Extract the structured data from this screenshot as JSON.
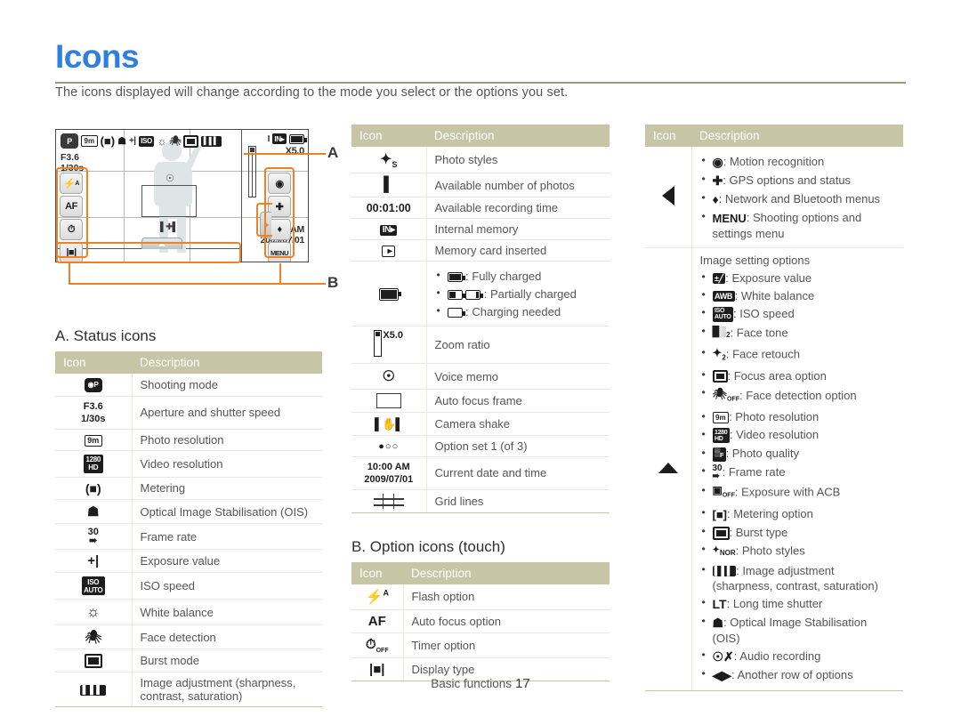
{
  "page": {
    "title": "Icons",
    "subtitle": "The icons displayed will change according to the mode you select or the options you set.",
    "footer_text": "Basic functions",
    "footer_page": "17",
    "accent_color": "#2e7fe0",
    "header_color": "#c6c5a6",
    "callout_color": "#f08020"
  },
  "diagram": {
    "label_a": "A",
    "label_b": "B",
    "aperture": "F3.6",
    "shutter": "1/30s",
    "zoom_ratio": "X5.0",
    "time": "10:00AM",
    "date": "2009/07/01",
    "mode_badge": "P",
    "left_buttons": [
      "flash-auto-icon",
      "af-icon",
      "timer-off-icon",
      "display-type-icon"
    ],
    "right_buttons": [
      "motion-recognition-icon",
      "gps-icon",
      "network-bluetooth-icon",
      "MENU"
    ],
    "menu_label": "MENU",
    "af_label": "AF"
  },
  "section_a": {
    "heading": "A. Status icons",
    "columns": [
      "Icon",
      "Description"
    ],
    "rows": [
      {
        "icon": "shooting-mode-icon",
        "desc": "Shooting mode"
      },
      {
        "icon": "aperture-shutter-icon",
        "desc": "Aperture and shutter speed",
        "icon_text_1": "F3.6",
        "icon_text_2": "1/30s"
      },
      {
        "icon": "photo-resolution-icon",
        "desc": "Photo resolution"
      },
      {
        "icon": "video-resolution-icon",
        "desc": "Video resolution"
      },
      {
        "icon": "metering-icon",
        "desc": "Metering"
      },
      {
        "icon": "ois-icon",
        "desc": "Optical Image Stabilisation (OIS)"
      },
      {
        "icon": "frame-rate-icon",
        "desc": "Frame rate"
      },
      {
        "icon": "exposure-value-icon",
        "desc": "Exposure value"
      },
      {
        "icon": "iso-speed-icon",
        "desc": "ISO speed"
      },
      {
        "icon": "white-balance-icon",
        "desc": "White balance"
      },
      {
        "icon": "face-detection-icon",
        "desc": "Face detection"
      },
      {
        "icon": "burst-mode-icon",
        "desc": "Burst mode"
      },
      {
        "icon": "image-adjustment-icon",
        "desc": "Image adjustment (sharpness, contrast, saturation)"
      }
    ]
  },
  "middle_table": {
    "columns": [
      "Icon",
      "Description"
    ],
    "rows": [
      {
        "icon": "photo-styles-icon",
        "desc": "Photo styles"
      },
      {
        "icon": "available-photos-icon",
        "desc": "Available number of photos"
      },
      {
        "icon": "recording-time-icon",
        "icon_text": "00:01:00",
        "desc": "Available recording time"
      },
      {
        "icon": "internal-memory-icon",
        "desc": "Internal memory"
      },
      {
        "icon": "memory-card-icon",
        "desc": "Memory card inserted"
      },
      {
        "icon": "battery-icon",
        "desc": "",
        "bullets": [
          "Fully charged",
          "Partially charged",
          "Charging needed"
        ]
      },
      {
        "icon": "zoom-ratio-icon",
        "icon_text": "X5.0",
        "desc": "Zoom ratio"
      },
      {
        "icon": "voice-memo-icon",
        "desc": "Voice memo"
      },
      {
        "icon": "auto-focus-frame-icon",
        "desc": "Auto focus frame"
      },
      {
        "icon": "camera-shake-icon",
        "desc": "Camera shake"
      },
      {
        "icon": "option-set-icon",
        "desc": "Option set 1 (of 3)"
      },
      {
        "icon": "date-time-icon",
        "icon_text_1": "10:00 AM",
        "icon_text_2": "2009/07/01",
        "desc": "Current date and time"
      },
      {
        "icon": "grid-lines-icon",
        "desc": "Grid lines"
      }
    ]
  },
  "section_b": {
    "heading": "B. Option icons (touch)",
    "columns": [
      "Icon",
      "Description"
    ],
    "rows": [
      {
        "icon": "flash-option-icon",
        "desc": "Flash option"
      },
      {
        "icon": "auto-focus-option-icon",
        "icon_text": "AF",
        "desc": "Auto focus option"
      },
      {
        "icon": "timer-option-icon",
        "desc": "Timer option"
      },
      {
        "icon": "display-type-icon",
        "desc": "Display type"
      }
    ]
  },
  "right_table": {
    "columns": [
      "Icon",
      "Description"
    ],
    "row1": {
      "icon": "left-triangle-icon",
      "bullets": [
        {
          "icon": "motion-recognition-icon",
          "text": "Motion recognition"
        },
        {
          "icon": "gps-icon",
          "text": "GPS options and status"
        },
        {
          "icon": "network-bluetooth-icon",
          "text": "Network and Bluetooth menus"
        },
        {
          "icon": "menu-icon",
          "label": "MENU",
          "text": "Shooting options and settings menu"
        }
      ]
    },
    "row2": {
      "icon": "up-triangle-icon",
      "note": "Image setting options",
      "bullets": [
        {
          "icon": "exposure-value-icon",
          "text": "Exposure value"
        },
        {
          "icon": "white-balance-icon",
          "text": "White balance"
        },
        {
          "icon": "iso-speed-icon",
          "text": "ISO speed"
        },
        {
          "icon": "face-tone-icon",
          "text": "Face tone"
        },
        {
          "icon": "face-retouch-icon",
          "text": "Face retouch"
        },
        {
          "icon": "focus-area-icon",
          "text": "Focus area option"
        },
        {
          "icon": "face-detection-option-icon",
          "text": "Face detection option"
        },
        {
          "icon": "photo-resolution-icon",
          "text": "Photo resolution"
        },
        {
          "icon": "video-resolution-icon",
          "text": "Video resolution"
        },
        {
          "icon": "photo-quality-icon",
          "text": "Photo quality"
        },
        {
          "icon": "frame-rate-icon",
          "text": "Frame rate"
        },
        {
          "icon": "acb-icon",
          "text": "Exposure with ACB"
        },
        {
          "icon": "metering-option-icon",
          "text": "Metering option"
        },
        {
          "icon": "burst-type-icon",
          "text": "Burst type"
        },
        {
          "icon": "photo-styles-icon",
          "text": "Photo styles"
        },
        {
          "icon": "image-adjustment-icon",
          "text": "Image adjustment (sharpness, contrast, saturation)"
        },
        {
          "icon": "long-time-shutter-icon",
          "label": "LT",
          "text": "Long time shutter"
        },
        {
          "icon": "ois-icon",
          "text": "Optical Image Stabilisation (OIS)"
        },
        {
          "icon": "audio-recording-icon",
          "text": "Audio recording"
        },
        {
          "icon": "another-row-icon",
          "text": "Another row of options"
        }
      ]
    }
  }
}
